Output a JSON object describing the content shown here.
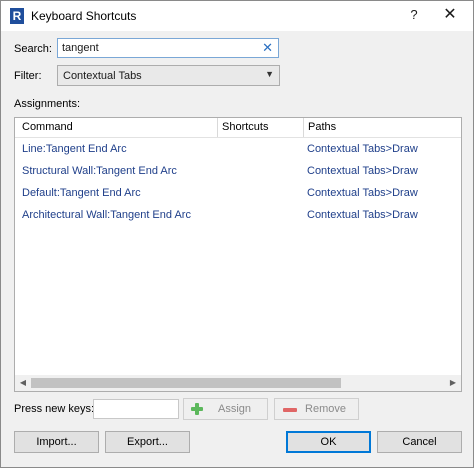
{
  "window": {
    "title": "Keyboard Shortcuts",
    "help": "?",
    "close": "✕",
    "app_icon": "R"
  },
  "search": {
    "label": "Search:",
    "value": "tangent",
    "clear": "✕"
  },
  "filter": {
    "label": "Filter:",
    "value": "Contextual Tabs",
    "arrow": "▼"
  },
  "assignments": {
    "label": "Assignments:",
    "columns": [
      "Command",
      "Shortcuts",
      "Paths"
    ],
    "rows": [
      {
        "command": "Line:Tangent End Arc",
        "shortcuts": "",
        "path": "Contextual Tabs>Draw"
      },
      {
        "command": "Structural Wall:Tangent End Arc",
        "shortcuts": "",
        "path": "Contextual Tabs>Draw"
      },
      {
        "command": "Default:Tangent End Arc",
        "shortcuts": "",
        "path": "Contextual Tabs>Draw"
      },
      {
        "command": "Architectural Wall:Tangent End Arc",
        "shortcuts": "",
        "path": "Contextual Tabs>Draw"
      }
    ],
    "scroll_left": "◀",
    "scroll_right": "▶"
  },
  "keys": {
    "label": "Press new keys:",
    "value": ""
  },
  "buttons": {
    "assign": "Assign",
    "remove": "Remove",
    "import": "Import...",
    "export": "Export...",
    "ok": "OK",
    "cancel": "Cancel"
  },
  "colors": {
    "accent": "#0078d7",
    "link_text": "#1f3f8a",
    "remove_icon": "#e06666",
    "assign_icon": "#5cb85c"
  }
}
